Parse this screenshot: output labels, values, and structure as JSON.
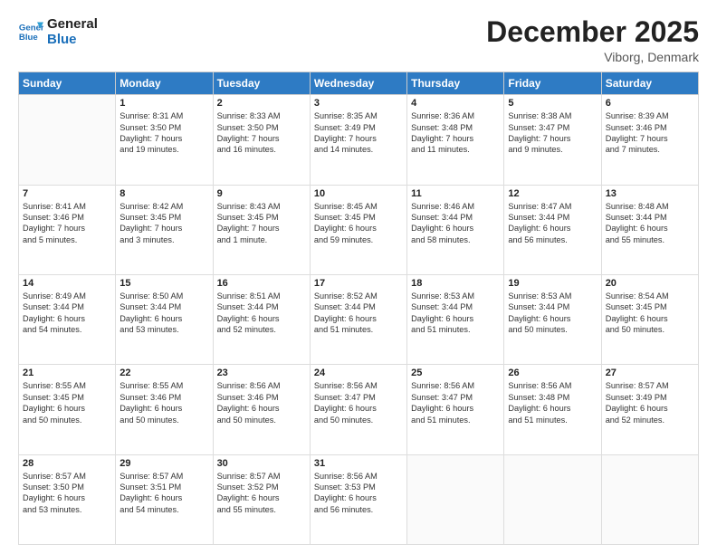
{
  "logo": {
    "line1": "General",
    "line2": "Blue"
  },
  "title": "December 2025",
  "location": "Viborg, Denmark",
  "days_header": [
    "Sunday",
    "Monday",
    "Tuesday",
    "Wednesday",
    "Thursday",
    "Friday",
    "Saturday"
  ],
  "weeks": [
    [
      {
        "day": "",
        "text": ""
      },
      {
        "day": "1",
        "text": "Sunrise: 8:31 AM\nSunset: 3:50 PM\nDaylight: 7 hours\nand 19 minutes."
      },
      {
        "day": "2",
        "text": "Sunrise: 8:33 AM\nSunset: 3:50 PM\nDaylight: 7 hours\nand 16 minutes."
      },
      {
        "day": "3",
        "text": "Sunrise: 8:35 AM\nSunset: 3:49 PM\nDaylight: 7 hours\nand 14 minutes."
      },
      {
        "day": "4",
        "text": "Sunrise: 8:36 AM\nSunset: 3:48 PM\nDaylight: 7 hours\nand 11 minutes."
      },
      {
        "day": "5",
        "text": "Sunrise: 8:38 AM\nSunset: 3:47 PM\nDaylight: 7 hours\nand 9 minutes."
      },
      {
        "day": "6",
        "text": "Sunrise: 8:39 AM\nSunset: 3:46 PM\nDaylight: 7 hours\nand 7 minutes."
      }
    ],
    [
      {
        "day": "7",
        "text": "Sunrise: 8:41 AM\nSunset: 3:46 PM\nDaylight: 7 hours\nand 5 minutes."
      },
      {
        "day": "8",
        "text": "Sunrise: 8:42 AM\nSunset: 3:45 PM\nDaylight: 7 hours\nand 3 minutes."
      },
      {
        "day": "9",
        "text": "Sunrise: 8:43 AM\nSunset: 3:45 PM\nDaylight: 7 hours\nand 1 minute."
      },
      {
        "day": "10",
        "text": "Sunrise: 8:45 AM\nSunset: 3:45 PM\nDaylight: 6 hours\nand 59 minutes."
      },
      {
        "day": "11",
        "text": "Sunrise: 8:46 AM\nSunset: 3:44 PM\nDaylight: 6 hours\nand 58 minutes."
      },
      {
        "day": "12",
        "text": "Sunrise: 8:47 AM\nSunset: 3:44 PM\nDaylight: 6 hours\nand 56 minutes."
      },
      {
        "day": "13",
        "text": "Sunrise: 8:48 AM\nSunset: 3:44 PM\nDaylight: 6 hours\nand 55 minutes."
      }
    ],
    [
      {
        "day": "14",
        "text": "Sunrise: 8:49 AM\nSunset: 3:44 PM\nDaylight: 6 hours\nand 54 minutes."
      },
      {
        "day": "15",
        "text": "Sunrise: 8:50 AM\nSunset: 3:44 PM\nDaylight: 6 hours\nand 53 minutes."
      },
      {
        "day": "16",
        "text": "Sunrise: 8:51 AM\nSunset: 3:44 PM\nDaylight: 6 hours\nand 52 minutes."
      },
      {
        "day": "17",
        "text": "Sunrise: 8:52 AM\nSunset: 3:44 PM\nDaylight: 6 hours\nand 51 minutes."
      },
      {
        "day": "18",
        "text": "Sunrise: 8:53 AM\nSunset: 3:44 PM\nDaylight: 6 hours\nand 51 minutes."
      },
      {
        "day": "19",
        "text": "Sunrise: 8:53 AM\nSunset: 3:44 PM\nDaylight: 6 hours\nand 50 minutes."
      },
      {
        "day": "20",
        "text": "Sunrise: 8:54 AM\nSunset: 3:45 PM\nDaylight: 6 hours\nand 50 minutes."
      }
    ],
    [
      {
        "day": "21",
        "text": "Sunrise: 8:55 AM\nSunset: 3:45 PM\nDaylight: 6 hours\nand 50 minutes."
      },
      {
        "day": "22",
        "text": "Sunrise: 8:55 AM\nSunset: 3:46 PM\nDaylight: 6 hours\nand 50 minutes."
      },
      {
        "day": "23",
        "text": "Sunrise: 8:56 AM\nSunset: 3:46 PM\nDaylight: 6 hours\nand 50 minutes."
      },
      {
        "day": "24",
        "text": "Sunrise: 8:56 AM\nSunset: 3:47 PM\nDaylight: 6 hours\nand 50 minutes."
      },
      {
        "day": "25",
        "text": "Sunrise: 8:56 AM\nSunset: 3:47 PM\nDaylight: 6 hours\nand 51 minutes."
      },
      {
        "day": "26",
        "text": "Sunrise: 8:56 AM\nSunset: 3:48 PM\nDaylight: 6 hours\nand 51 minutes."
      },
      {
        "day": "27",
        "text": "Sunrise: 8:57 AM\nSunset: 3:49 PM\nDaylight: 6 hours\nand 52 minutes."
      }
    ],
    [
      {
        "day": "28",
        "text": "Sunrise: 8:57 AM\nSunset: 3:50 PM\nDaylight: 6 hours\nand 53 minutes."
      },
      {
        "day": "29",
        "text": "Sunrise: 8:57 AM\nSunset: 3:51 PM\nDaylight: 6 hours\nand 54 minutes."
      },
      {
        "day": "30",
        "text": "Sunrise: 8:57 AM\nSunset: 3:52 PM\nDaylight: 6 hours\nand 55 minutes."
      },
      {
        "day": "31",
        "text": "Sunrise: 8:56 AM\nSunset: 3:53 PM\nDaylight: 6 hours\nand 56 minutes."
      },
      {
        "day": "",
        "text": ""
      },
      {
        "day": "",
        "text": ""
      },
      {
        "day": "",
        "text": ""
      }
    ]
  ]
}
